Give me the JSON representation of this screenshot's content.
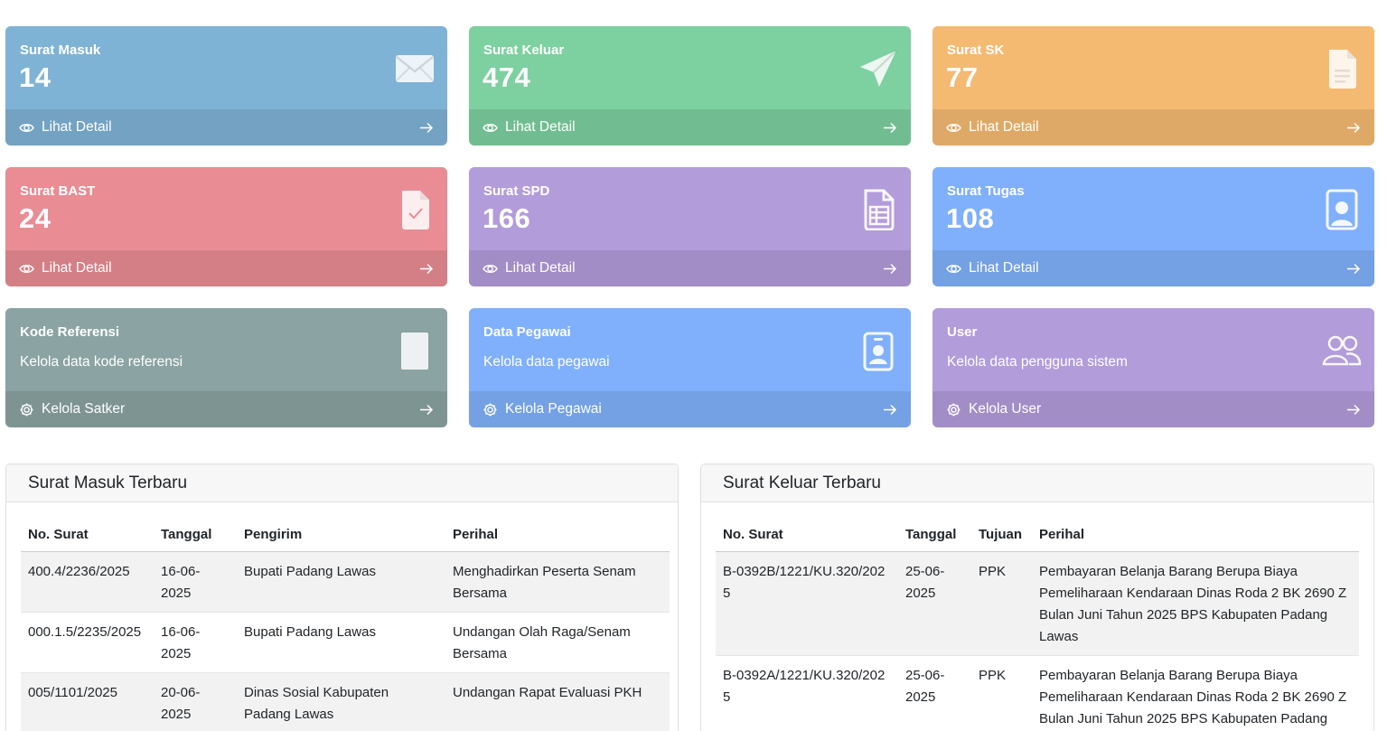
{
  "cards": [
    {
      "title": "Surat Masuk",
      "count": "14",
      "footer": "Lihat Detail",
      "icon": "envelope-icon",
      "footer_icon": "eye-icon",
      "color": "#7fb3d6"
    },
    {
      "title": "Surat Keluar",
      "count": "474",
      "footer": "Lihat Detail",
      "icon": "send-icon",
      "footer_icon": "eye-icon",
      "color": "#7dd0a0"
    },
    {
      "title": "Surat SK",
      "count": "77",
      "footer": "Lihat Detail",
      "icon": "document-icon",
      "footer_icon": "eye-icon",
      "color": "#f4ba72"
    },
    {
      "title": "Surat BAST",
      "count": "24",
      "footer": "Lihat Detail",
      "icon": "file-check-icon",
      "footer_icon": "eye-icon",
      "color": "#e98c94"
    },
    {
      "title": "Surat SPD",
      "count": "166",
      "footer": "Lihat Detail",
      "icon": "file-spreadsheet-icon",
      "footer_icon": "eye-icon",
      "color": "#b29cda"
    },
    {
      "title": "Surat Tugas",
      "count": "108",
      "footer": "Lihat Detail",
      "icon": "file-person-icon",
      "footer_icon": "eye-icon",
      "color": "#80b0fb"
    },
    {
      "title": "Kode Referensi",
      "desc": "Kelola data kode referensi",
      "footer": "Kelola Satker",
      "icon": "book-icon",
      "footer_icon": "gear-icon",
      "color": "#8ba3a2"
    },
    {
      "title": "Data Pegawai",
      "desc": "Kelola data pegawai",
      "footer": "Kelola Pegawai",
      "icon": "badge-icon",
      "footer_icon": "gear-icon",
      "color": "#80b0fb"
    },
    {
      "title": "User",
      "desc": "Kelola data pengguna sistem",
      "footer": "Kelola User",
      "icon": "people-icon",
      "footer_icon": "gear-icon",
      "color": "#b29cda"
    }
  ],
  "incoming": {
    "title": "Surat Masuk Terbaru",
    "headers": [
      "No. Surat",
      "Tanggal",
      "Pengirim",
      "Perihal"
    ],
    "rows": [
      [
        "400.4/2236/2025",
        "16-06-2025",
        "Bupati Padang Lawas",
        "Menghadirkan Peserta Senam Bersama"
      ],
      [
        "000.1.5/2235/2025",
        "16-06-2025",
        "Bupati Padang Lawas",
        "Undangan Olah Raga/Senam Bersama"
      ],
      [
        "005/1101/2025",
        "20-06-2025",
        "Dinas Sosial Kabupaten Padang Lawas",
        "Undangan Rapat Evaluasi PKH"
      ]
    ]
  },
  "outgoing": {
    "title": "Surat Keluar Terbaru",
    "headers": [
      "No. Surat",
      "Tanggal",
      "Tujuan",
      "Perihal"
    ],
    "rows": [
      [
        "B-0392B/1221/KU.320/2025",
        "25-06-2025",
        "PPK",
        "Pembayaran Belanja Barang Berupa Biaya Pemeliharaan Kendaraan Dinas Roda 2 BK 2690 Z Bulan Juni Tahun 2025 BPS Kabupaten Padang Lawas"
      ],
      [
        "B-0392A/1221/KU.320/2025",
        "25-06-2025",
        "PPK",
        "Pembayaran Belanja Barang Berupa Biaya Pemeliharaan Kendaraan Dinas Roda 2 BK 2690 Z Bulan Juni Tahun 2025 BPS Kabupaten Padang Lawas"
      ]
    ]
  }
}
